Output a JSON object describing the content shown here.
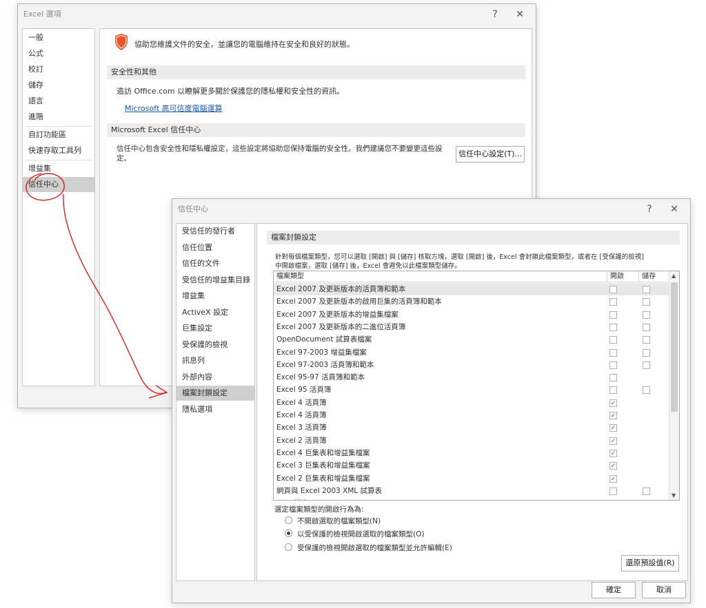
{
  "excel_options": {
    "title": "Excel 選項",
    "help": "?",
    "close": "✕",
    "nav": [
      "一般",
      "公式",
      "校訂",
      "儲存",
      "語言",
      "進階",
      "自訂功能區",
      "快速存取工具列",
      "增益集",
      "信任中心"
    ],
    "intro": "協助您維護文件的安全，並讓您的電腦維持在安全和良好的狀態。",
    "privacy_section": "安全性和其他",
    "privacy_text": "造訪 Office.com 以瞭解更多關於保護您的隱私權和安全性的資訊。",
    "privacy_link": "Microsoft 高可信度電腦運算",
    "trust_section": "Microsoft Excel 信任中心",
    "trust_text_1": "信任中心包含安全性和隱私權設定，這些設定將協助您保持電腦的安全性。我們建議您不要變更這些設",
    "trust_text_2": "定。",
    "trust_button": "信任中心設定(T)..."
  },
  "trust_center": {
    "title": "信任中心",
    "help": "?",
    "close": "✕",
    "nav": [
      "受信任的發行者",
      "信任位置",
      "信任的文件",
      "受信任的增益集目錄",
      "增益集",
      "ActiveX 設定",
      "巨集設定",
      "受保護的檢視",
      "訊息列",
      "外部內容",
      "檔案封鎖設定",
      "隱私選項"
    ],
    "section_title": "檔案封鎖設定",
    "desc_1": "針對每個檔案類型，您可以選取 [開啟] 與 [儲存] 核取方塊，選取 [開啟] 後，Excel 會封鎖此檔案類型，或者在 [受保護的檢視]",
    "desc_2": "中開啟檔案，選取 [儲存] 後，Excel 會避免以此檔案類型儲存。",
    "col_type": "檔案類型",
    "col_open": "開啟",
    "col_save": "儲存",
    "rows": [
      {
        "name": "Excel 2007 及更新版本的活頁簿和範本",
        "open": "",
        "save": ""
      },
      {
        "name": "Excel 2007 及更新版本的啟用巨集的活頁簿和範本",
        "open": "",
        "save": ""
      },
      {
        "name": "Excel 2007 及更新版本的增益集檔案",
        "open": "",
        "save": ""
      },
      {
        "name": "Excel 2007 及更新版本的二進位活頁簿",
        "open": "",
        "save": ""
      },
      {
        "name": "OpenDocument 試算表檔案",
        "open": "",
        "save": ""
      },
      {
        "name": "Excel 97-2003 增益集檔案",
        "open": "",
        "save": ""
      },
      {
        "name": "Excel 97-2003 活頁簿和範本",
        "open": "",
        "save": ""
      },
      {
        "name": "Excel 95-97 活頁簿和範本",
        "open": "",
        "save": "none"
      },
      {
        "name": "Excel 95 活頁簿",
        "open": "",
        "save": ""
      },
      {
        "name": "Excel 4 活頁簿",
        "open": "✓",
        "save": "none"
      },
      {
        "name": "Excel 4 活頁簿",
        "open": "✓",
        "save": "none"
      },
      {
        "name": "Excel 3 活頁簿",
        "open": "✓",
        "save": "none"
      },
      {
        "name": "Excel 2 活頁簿",
        "open": "✓",
        "save": "none"
      },
      {
        "name": "Excel 4 巨集表和增益集檔案",
        "open": "✓",
        "save": "none"
      },
      {
        "name": "Excel 3 巨集表和增益集檔案",
        "open": "✓",
        "save": "none"
      },
      {
        "name": "Excel 2 巨集表和增益集檔案",
        "open": "✓",
        "save": "none"
      },
      {
        "name": "網頁與 Excel 2003 XML 試算表",
        "open": "",
        "save": ""
      },
      {
        "name": "XML 檔案",
        "open": "",
        "save": ""
      }
    ],
    "open_behavior_label": "選定檔案類型的開啟行為為:",
    "options": [
      {
        "label": "不開啟選取的檔案類型(N)",
        "selected": false
      },
      {
        "label": "以受保護的檢視開啟選取的檔案類型(O)",
        "selected": true
      },
      {
        "label": "受保護的檢視開啟選取的檔案類型並允許編輯(E)",
        "selected": false
      }
    ],
    "restore_button": "還原預設值(R)",
    "ok_button": "確定",
    "cancel_button": "取消"
  },
  "colors": {
    "shield": "#e8562a",
    "link": "#1f5aa8",
    "annotation": "#d42020"
  }
}
